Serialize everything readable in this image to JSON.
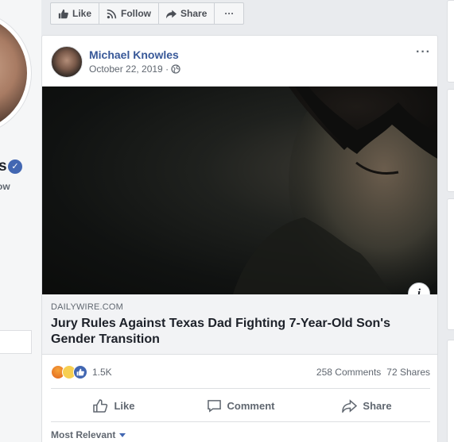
{
  "action_bar": {
    "like": "Like",
    "follow": "Follow",
    "share": "Share",
    "more": "···"
  },
  "sidebar": {
    "name_fragment": "s",
    "handle_fragment": "ow",
    "verified": "✓"
  },
  "post": {
    "author": "Michael Knowles",
    "date": "October 22, 2019 · ",
    "more": "···",
    "link": {
      "domain": "DAILYWIRE.COM",
      "title": "Jury Rules Against Texas Dad Fighting 7-Year-Old Son's Gender Transition",
      "info": "i"
    },
    "reactions": {
      "count": "1.5K",
      "comments": "258 Comments",
      "shares": "72 Shares"
    },
    "buttons": {
      "like": "Like",
      "comment": "Comment",
      "share": "Share"
    },
    "sort": "Most Relevant"
  },
  "colors": {
    "link_blue": "#385898",
    "fb_blue": "#4267b2",
    "muted": "#606770"
  }
}
